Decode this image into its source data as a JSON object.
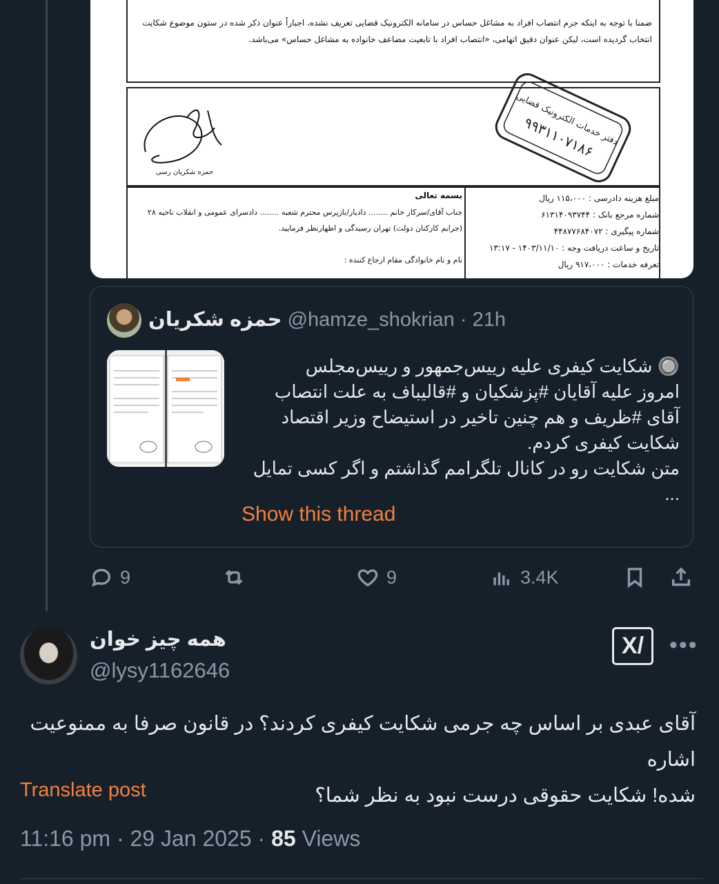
{
  "document": {
    "paragraph_lines": [
      "ضمنا با توجه به اینکه جرم انتصاب افراد به مشاغل حساس در سامانه الکترونیک قضایی تعریف نشده، اجباراً عنوان ذکر شده در ستون موضوع شکایت",
      "انتخاب گردیده است، لیکن عنوان دقیق اتهامی، «انتصاب افراد با تابعیت مضاعف خانواده به مشاغل حساس» می‌باشد."
    ],
    "signature_name": "حمزه شکریان رسی",
    "stamp_text": "دفتر خدمات الکترونیک قضایی",
    "stamp_number": "۹۹۳۱۱۰۷۱۸۶",
    "bismillah": "بسمه تعالی",
    "address_lines": [
      "جناب آقای/سرکار خانم ........ دادیار/بازپرس محترم شعبه ........ دادسرای عمومی و انقلاب ناحیه ۲۸",
      "(جرایم کارکنان دولت) تهران رسیدگی و اظهارنظر فرمایید.",
      "نام و نام خانوادگی مقام ارجاع کننده :"
    ],
    "fee_lines": [
      "مبلغ هزینه دادرسی : ۱۱۵،۰۰۰ ریال",
      "شماره مرجع بانک : ۶۱۳۱۴۰۹۳۷۴۴",
      "شماره پیگیری : ۴۴۸۷۷۶۸۴۰۷۲",
      "تاریخ و ساعت دریافت وجه : ۱۴۰۳/۱۱/۱۰ - ۱۳:۱۷",
      "تعرفه خدمات : ۹۱۷،۰۰۰ ریال"
    ]
  },
  "quote": {
    "name": "حمزه شکریان",
    "handle": "@hamze_shokrian",
    "separator": "·",
    "time": "21h",
    "lines": [
      "🔘 شکایت کیفری علیه رییس‌جمهور و رییس‌مجلس",
      "امروز علیه آقایان #پزشکیان و #قالیباف به علت انتصاب",
      "آقای #ظریف و هم چنین تاخیر در استیضاح وزیر اقتصاد",
      "شکایت کیفری کردم.",
      "متن شکایت رو در کانال تلگرامم گذاشتم و اگر کسی تمایل ..."
    ],
    "show_thread": "Show this thread"
  },
  "actions": {
    "replies": "9",
    "likes": "9",
    "views": "3.4K"
  },
  "tweet": {
    "name": "همه چیز خوان",
    "handle": "@lysy1162646",
    "grok_label": "X/",
    "more": "•••",
    "text_lines": [
      "آقای عبدی بر اساس چه جرمی شکایت کیفری کردند؟ در قانون صرفا به ممنوعیت اشاره",
      "شده! شکایت حقوقی درست نبود به نظر شما؟"
    ],
    "translate": "Translate post",
    "time": "11:16 pm",
    "date": "29 Jan 2025",
    "views_count": "85",
    "views_label": "Views",
    "separator": "·"
  },
  "colors": {
    "background": "#15202b",
    "accent": "#f5803b",
    "muted": "#8b98a5",
    "border": "#38444d"
  }
}
